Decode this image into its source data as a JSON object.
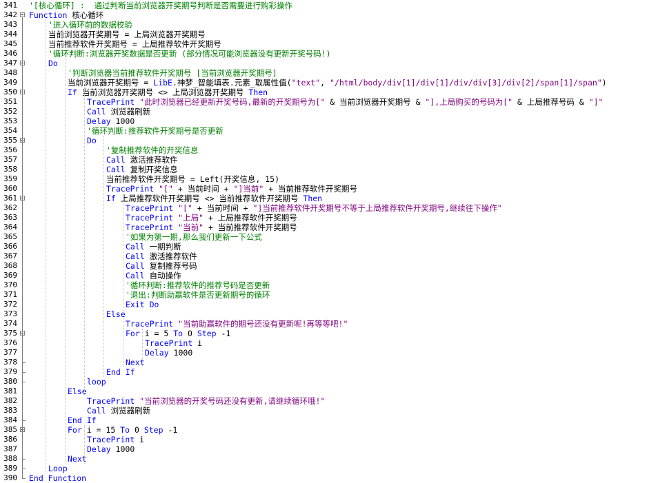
{
  "editor": {
    "lines": [
      {
        "n": "341",
        "indent": 0,
        "segs": [
          {
            "t": "'[核心循环] :  通过判断当前浏览器开奖期号判断是否需要进行购彩操作",
            "c": "cm"
          }
        ]
      },
      {
        "n": "342",
        "indent": 0,
        "segs": [
          {
            "t": "Function ",
            "c": "kw"
          },
          {
            "t": "核心循环",
            "c": "tx"
          }
        ]
      },
      {
        "n": "343",
        "indent": 1,
        "segs": [
          {
            "t": "'进入循环前的数据校验",
            "c": "cm"
          }
        ]
      },
      {
        "n": "344",
        "indent": 1,
        "segs": [
          {
            "t": "当前浏览器开奖期号 = 上局浏览器开奖期号",
            "c": "tx"
          }
        ]
      },
      {
        "n": "345",
        "indent": 1,
        "segs": [
          {
            "t": "当前推荐软件开奖期号 = 上局推荐软件开奖期号",
            "c": "tx"
          }
        ]
      },
      {
        "n": "346",
        "indent": 1,
        "segs": [
          {
            "t": "'循环判断:浏览器开奖数据是否更新 (部分情况可能浏览器没有更新开奖号码!)",
            "c": "cm"
          }
        ]
      },
      {
        "n": "347",
        "indent": 1,
        "segs": [
          {
            "t": "Do",
            "c": "kw"
          }
        ]
      },
      {
        "n": "348",
        "indent": 2,
        "segs": [
          {
            "t": "'判断浏览器当前推荐软件开奖期号 [当前浏览器开奖期号]",
            "c": "cm"
          }
        ]
      },
      {
        "n": "349",
        "indent": 2,
        "segs": [
          {
            "t": "当前浏览器开奖期号 = ",
            "c": "tx"
          },
          {
            "t": "LibE",
            "c": "kw"
          },
          {
            "t": ".神梦_智能填表.元素_取属性值(",
            "c": "tx"
          },
          {
            "t": "\"text\"",
            "c": "st"
          },
          {
            "t": ", ",
            "c": "tx"
          },
          {
            "t": "\"/html/body/div[1]/div[1]/div/div[3]/div[2]/span[1]/span\"",
            "c": "st"
          },
          {
            "t": ")",
            "c": "tx"
          }
        ]
      },
      {
        "n": "350",
        "indent": 2,
        "segs": [
          {
            "t": "If ",
            "c": "kw"
          },
          {
            "t": "当前浏览器开奖期号 <> 上局浏览器开奖期号 ",
            "c": "tx"
          },
          {
            "t": "Then",
            "c": "kw"
          }
        ]
      },
      {
        "n": "351",
        "indent": 3,
        "segs": [
          {
            "t": "TracePrint ",
            "c": "kw"
          },
          {
            "t": "\"此时浏览器已经更新开奖号码,最新的开奖期号为[\"",
            "c": "st"
          },
          {
            "t": " & 当前浏览器开奖期号 & ",
            "c": "tx"
          },
          {
            "t": "\"],上局购买的号码为[\"",
            "c": "st"
          },
          {
            "t": " & 上局推荐号码 & ",
            "c": "tx"
          },
          {
            "t": "\"]\"",
            "c": "st"
          }
        ]
      },
      {
        "n": "352",
        "indent": 3,
        "segs": [
          {
            "t": "Call ",
            "c": "kw"
          },
          {
            "t": "浏览器刷新",
            "c": "tx"
          }
        ]
      },
      {
        "n": "353",
        "indent": 3,
        "segs": [
          {
            "t": "Delay ",
            "c": "kw"
          },
          {
            "t": "1000",
            "c": "tx"
          }
        ]
      },
      {
        "n": "354",
        "indent": 3,
        "segs": [
          {
            "t": "'循环判断:推荐软件开奖期号是否更新",
            "c": "cm"
          }
        ]
      },
      {
        "n": "355",
        "indent": 3,
        "segs": [
          {
            "t": "Do",
            "c": "kw"
          }
        ]
      },
      {
        "n": "356",
        "indent": 4,
        "segs": [
          {
            "t": "'复制推荐软件的开奖信息",
            "c": "cm"
          }
        ]
      },
      {
        "n": "357",
        "indent": 4,
        "segs": [
          {
            "t": "Call ",
            "c": "kw"
          },
          {
            "t": "激活推荐软件",
            "c": "tx"
          }
        ]
      },
      {
        "n": "358",
        "indent": 4,
        "segs": [
          {
            "t": "Call ",
            "c": "kw"
          },
          {
            "t": "复制开奖信息",
            "c": "tx"
          }
        ]
      },
      {
        "n": "359",
        "indent": 4,
        "segs": [
          {
            "t": "当前推荐软件开奖期号 = Left(开奖信息, 15)",
            "c": "tx"
          }
        ]
      },
      {
        "n": "360",
        "indent": 4,
        "segs": [
          {
            "t": "TracePrint ",
            "c": "kw"
          },
          {
            "t": "\"[\"",
            "c": "st"
          },
          {
            "t": " + 当前时间 + ",
            "c": "tx"
          },
          {
            "t": "\"]当前\"",
            "c": "st"
          },
          {
            "t": " + 当前推荐软件开奖期号",
            "c": "tx"
          }
        ]
      },
      {
        "n": "361",
        "indent": 4,
        "segs": [
          {
            "t": "If ",
            "c": "kw"
          },
          {
            "t": "上局推荐软件开奖期号 <> 当前推荐软件开奖期号 ",
            "c": "tx"
          },
          {
            "t": "Then",
            "c": "kw"
          }
        ]
      },
      {
        "n": "362",
        "indent": 5,
        "segs": [
          {
            "t": "TracePrint ",
            "c": "kw"
          },
          {
            "t": "\"[\"",
            "c": "st"
          },
          {
            "t": " + 当前时间 + ",
            "c": "tx"
          },
          {
            "t": "\"]当前推荐软件开奖期号不等于上局推荐软件开奖期号,继续往下操作\"",
            "c": "st"
          }
        ]
      },
      {
        "n": "363",
        "indent": 5,
        "segs": [
          {
            "t": "TracePrint ",
            "c": "kw"
          },
          {
            "t": "\"上局\"",
            "c": "st"
          },
          {
            "t": " + 上局推荐软件开奖期号",
            "c": "tx"
          }
        ]
      },
      {
        "n": "364",
        "indent": 5,
        "segs": [
          {
            "t": "TracePrint ",
            "c": "kw"
          },
          {
            "t": "\"当前\"",
            "c": "st"
          },
          {
            "t": " + 当前推荐软件开奖期号",
            "c": "tx"
          }
        ]
      },
      {
        "n": "365",
        "indent": 5,
        "segs": [
          {
            "t": "'如果为第一期,那么我们更新一下公式",
            "c": "cm"
          }
        ]
      },
      {
        "n": "366",
        "indent": 5,
        "segs": [
          {
            "t": "Call ",
            "c": "kw"
          },
          {
            "t": "一期判断",
            "c": "tx"
          }
        ]
      },
      {
        "n": "367",
        "indent": 5,
        "segs": [
          {
            "t": "Call ",
            "c": "kw"
          },
          {
            "t": "激活推荐软件",
            "c": "tx"
          }
        ]
      },
      {
        "n": "368",
        "indent": 5,
        "segs": [
          {
            "t": "Call ",
            "c": "kw"
          },
          {
            "t": "复制推荐号码",
            "c": "tx"
          }
        ]
      },
      {
        "n": "369",
        "indent": 5,
        "segs": [
          {
            "t": "Call ",
            "c": "kw"
          },
          {
            "t": "自动操作",
            "c": "tx"
          }
        ]
      },
      {
        "n": "370",
        "indent": 5,
        "segs": [
          {
            "t": "'循环判断:推荐软件的推荐号码是否更新",
            "c": "cm"
          }
        ]
      },
      {
        "n": "371",
        "indent": 5,
        "segs": [
          {
            "t": "'退出:判断助赢软件是否更新期号的循环",
            "c": "cm"
          }
        ]
      },
      {
        "n": "372",
        "indent": 5,
        "segs": [
          {
            "t": "Exit Do",
            "c": "kw"
          }
        ]
      },
      {
        "n": "373",
        "indent": 4,
        "segs": [
          {
            "t": "Else",
            "c": "kw"
          }
        ]
      },
      {
        "n": "374",
        "indent": 5,
        "segs": [
          {
            "t": "TracePrint ",
            "c": "kw"
          },
          {
            "t": "\"当前助赢软件的期号还没有更新呢!再等等吧!\"",
            "c": "st"
          }
        ]
      },
      {
        "n": "375",
        "indent": 5,
        "segs": [
          {
            "t": "For ",
            "c": "kw"
          },
          {
            "t": "i = 5 ",
            "c": "tx"
          },
          {
            "t": "To ",
            "c": "kw"
          },
          {
            "t": "0 ",
            "c": "tx"
          },
          {
            "t": "Step ",
            "c": "kw"
          },
          {
            "t": "-1",
            "c": "tx"
          }
        ]
      },
      {
        "n": "376",
        "indent": 6,
        "segs": [
          {
            "t": "TracePrint ",
            "c": "kw"
          },
          {
            "t": "i",
            "c": "tx"
          }
        ]
      },
      {
        "n": "377",
        "indent": 6,
        "segs": [
          {
            "t": "Delay ",
            "c": "kw"
          },
          {
            "t": "1000",
            "c": "tx"
          }
        ]
      },
      {
        "n": "378",
        "indent": 5,
        "segs": [
          {
            "t": "Next",
            "c": "kw"
          }
        ]
      },
      {
        "n": "379",
        "indent": 4,
        "segs": [
          {
            "t": "End If",
            "c": "kw"
          }
        ]
      },
      {
        "n": "380",
        "indent": 3,
        "segs": [
          {
            "t": "loop",
            "c": "kw"
          }
        ]
      },
      {
        "n": "381",
        "indent": 2,
        "segs": [
          {
            "t": "Else",
            "c": "kw"
          }
        ]
      },
      {
        "n": "382",
        "indent": 3,
        "segs": [
          {
            "t": "TracePrint ",
            "c": "kw"
          },
          {
            "t": "\"当前浏览器的开奖号码还没有更新,请继续循环哦!\"",
            "c": "st"
          }
        ]
      },
      {
        "n": "383",
        "indent": 3,
        "segs": [
          {
            "t": "Call ",
            "c": "kw"
          },
          {
            "t": "浏览器刷新",
            "c": "tx"
          }
        ]
      },
      {
        "n": "384",
        "indent": 2,
        "segs": [
          {
            "t": "End If",
            "c": "kw"
          }
        ]
      },
      {
        "n": "385",
        "indent": 2,
        "segs": [
          {
            "t": "For ",
            "c": "kw"
          },
          {
            "t": "i = 15 ",
            "c": "tx"
          },
          {
            "t": "To ",
            "c": "kw"
          },
          {
            "t": "0 ",
            "c": "tx"
          },
          {
            "t": "Step ",
            "c": "kw"
          },
          {
            "t": "-1",
            "c": "tx"
          }
        ]
      },
      {
        "n": "386",
        "indent": 3,
        "segs": [
          {
            "t": "TracePrint ",
            "c": "kw"
          },
          {
            "t": "i",
            "c": "tx"
          }
        ]
      },
      {
        "n": "387",
        "indent": 3,
        "segs": [
          {
            "t": "Delay ",
            "c": "kw"
          },
          {
            "t": "1000",
            "c": "tx"
          }
        ]
      },
      {
        "n": "388",
        "indent": 2,
        "segs": [
          {
            "t": "Next",
            "c": "kw"
          }
        ]
      },
      {
        "n": "389",
        "indent": 1,
        "segs": [
          {
            "t": "Loop",
            "c": "kw"
          }
        ]
      },
      {
        "n": "390",
        "indent": 0,
        "segs": [
          {
            "t": "End Function",
            "c": "kw"
          }
        ]
      }
    ]
  },
  "colors": {
    "keyword": "#0000ff",
    "comment": "#008000",
    "string": "#7f007f",
    "text": "#000000",
    "background": "#ffffff"
  }
}
